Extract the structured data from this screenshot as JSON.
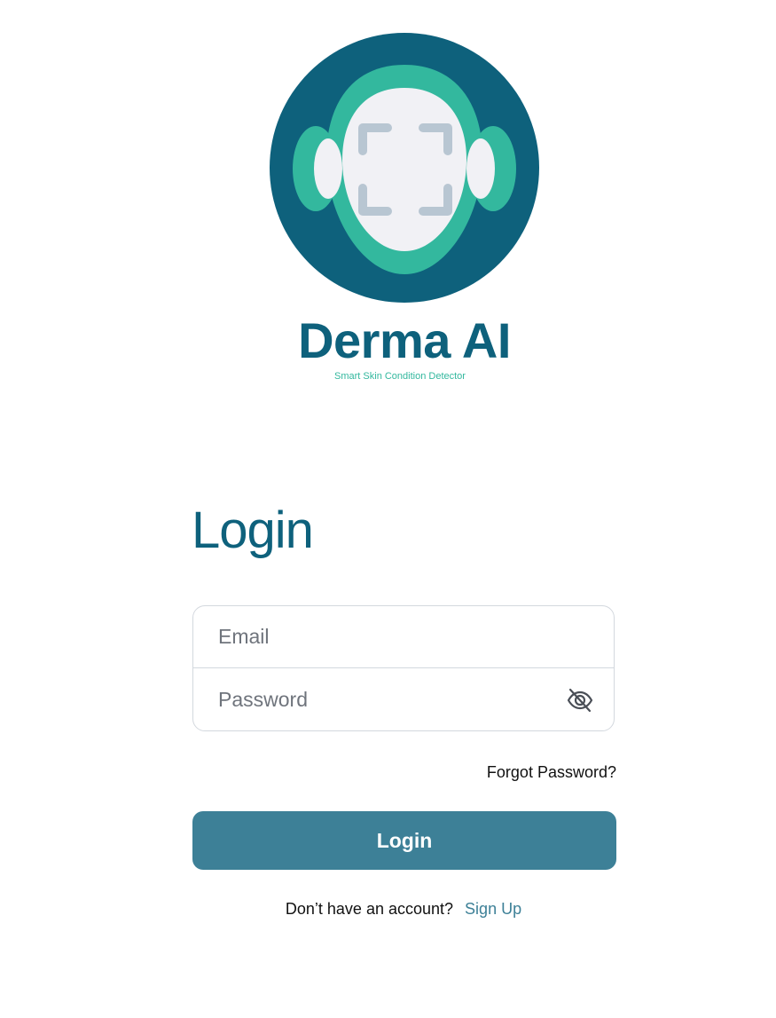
{
  "brand": {
    "name": "Derma AI",
    "tagline": "Smart Skin Condition Detector",
    "logo_icon": "face-scan-icon",
    "colors": {
      "primary_dark": "#0e617c",
      "accent_green": "#33b89e",
      "face_fill": "#f1f1f5",
      "scan_brackets": "#b8c6d2"
    }
  },
  "login": {
    "heading": "Login",
    "email_placeholder": "Email",
    "password_placeholder": "Password",
    "password_toggle_icon": "eye-off-icon",
    "forgot_password": "Forgot Password?",
    "submit_label": "Login",
    "button_color": "#3d8097"
  },
  "signup": {
    "prompt": "Don’t have an account?",
    "link": "Sign Up"
  }
}
